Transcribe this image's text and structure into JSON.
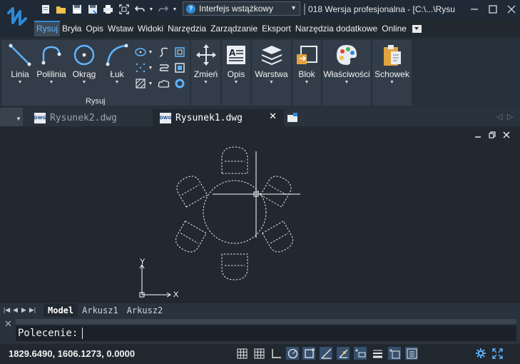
{
  "titlebar": {
    "workspace": "Interfejs wstążkowy",
    "window_title": "018 Wersja profesjonalna - [C:\\...\\Rysu",
    "qat_icons": [
      "new-icon",
      "open-icon",
      "save-icon",
      "save-as-icon",
      "print-icon",
      "zoom-extents-icon",
      "undo-icon",
      "redo-icon"
    ]
  },
  "menu": {
    "items": [
      "Rysuj",
      "Bryła",
      "Opis",
      "Wstaw",
      "Widoki",
      "Narzędzia",
      "Zarządzanie",
      "Eksport",
      "Narzędzia dodatkowe",
      "Online"
    ],
    "active": "Rysuj"
  },
  "ribbon": {
    "draw_tools": [
      {
        "label": "Linia",
        "icon": "line-icon"
      },
      {
        "label": "Polilinia",
        "icon": "polyline-icon"
      },
      {
        "label": "Okrąg",
        "icon": "circle-icon"
      },
      {
        "label": "Łuk",
        "icon": "arc-icon"
      }
    ],
    "draw_panel_title": "Rysuj",
    "panels": [
      {
        "label": "Zmień",
        "icon": "move-icon"
      },
      {
        "label": "Opis",
        "icon": "annotation-icon"
      },
      {
        "label": "Warstwa",
        "icon": "layers-icon"
      },
      {
        "label": "Blok",
        "icon": "block-icon"
      },
      {
        "label": "Właściwości",
        "icon": "properties-palette-icon"
      },
      {
        "label": "Schowek",
        "icon": "clipboard-icon"
      }
    ]
  },
  "tabs": {
    "documents": [
      {
        "name": "Rysunek2.dwg",
        "active": false
      },
      {
        "name": "Rysunek1.dwg",
        "active": true
      }
    ],
    "close": "✕",
    "dwg_badge": "DWG"
  },
  "canvas": {
    "ucs_x": "X",
    "ucs_y": "Y"
  },
  "layout_tabs": [
    "Model",
    "Arkusz1",
    "Arkusz2"
  ],
  "command": {
    "prompt": "Polecenie:"
  },
  "status": {
    "coordinates": "1829.6490, 1606.1273, 0.0000"
  },
  "colors": {
    "accent": "#2d8ad8",
    "background": "#212830",
    "ribbon": "#323d49"
  }
}
